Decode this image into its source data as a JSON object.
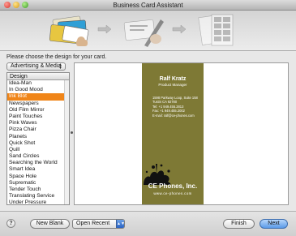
{
  "window": {
    "title": "Business Card Assistant"
  },
  "steps": [
    {
      "icon": "choose-design-icon",
      "active": true
    },
    {
      "icon": "edit-card-icon",
      "active": false
    },
    {
      "icon": "print-layout-icon",
      "active": false
    }
  ],
  "chooser": {
    "prompt": "Please choose the design for your card.",
    "category": "Advertising & Media",
    "list_header": "Design",
    "items": [
      "Idea-Man",
      "In Good Mood",
      "Ink Blot",
      "Newspapers",
      "Old Film Mirror",
      "Paint Touches",
      "Pink Waves",
      "Pizza Chair",
      "Planets",
      "Quick Shot",
      "Quill",
      "Sand Circles",
      "Searching the World",
      "Smart Idea",
      "Space Hole",
      "Suprematic",
      "Tender Touch",
      "Translating Service",
      "Under Pressure"
    ],
    "selected_index": 2
  },
  "card": {
    "name": "Ralf Kratz",
    "role": "Product Manager",
    "address1": "1598 Parkway Loop, Suite 158",
    "address2": "Tustin CA 92780",
    "tel": "Tel: +1 949.455.2813",
    "fax": "Fax: +1 949.455.2002",
    "email": "E-mail: ralf@ce-phones.com",
    "company": "CE Phones, Inc.",
    "website": "www.ce-phones.com",
    "background_color": "#7e7935"
  },
  "buttons": {
    "help": "?",
    "new_blank": "New Blank",
    "open_recent": "Open Recent",
    "finish": "Finish",
    "next": "Next"
  },
  "colors": {
    "selection": "#f08518",
    "default_button": "#5a9ae8"
  }
}
